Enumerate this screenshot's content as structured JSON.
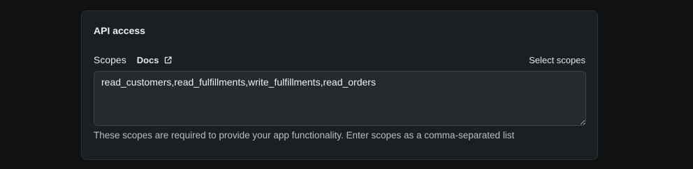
{
  "card": {
    "title": "API access"
  },
  "scopes": {
    "label": "Scopes",
    "docs_label": "Docs",
    "docs_icon": "external-link-icon",
    "select_label": "Select scopes",
    "value": "read_customers,read_fulfillments,write_fulfillments,read_orders",
    "helper": "These scopes are required to provide your app functionality. Enter scopes as a comma-separated list"
  },
  "colors": {
    "page_background": "#0f1112",
    "card_background": "#1b1f21",
    "input_background": "#252a2c",
    "link_text": "#dfe5ee",
    "helper_text": "#b8bdc0"
  }
}
